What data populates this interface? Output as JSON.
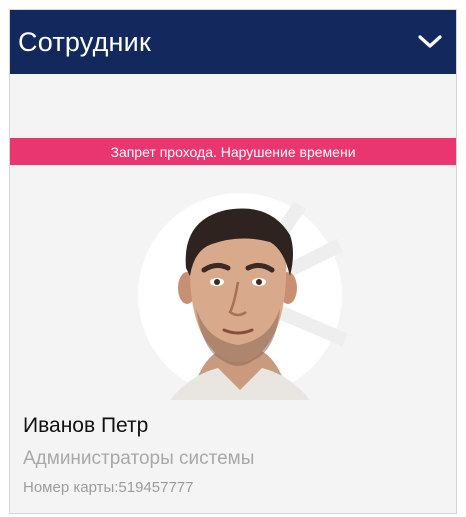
{
  "header": {
    "title": "Сотрудник",
    "toggle_icon": "chevron-down-icon"
  },
  "alert": {
    "text": "Запрет прохода. Нарушение времени",
    "color": "#ea3670"
  },
  "employee": {
    "name": "Иванов Петр",
    "group": "Администраторы системы",
    "card_number": "Номер карты:519457777"
  },
  "colors": {
    "header_bg": "#13295e",
    "card_bg": "#f4f4f4"
  }
}
